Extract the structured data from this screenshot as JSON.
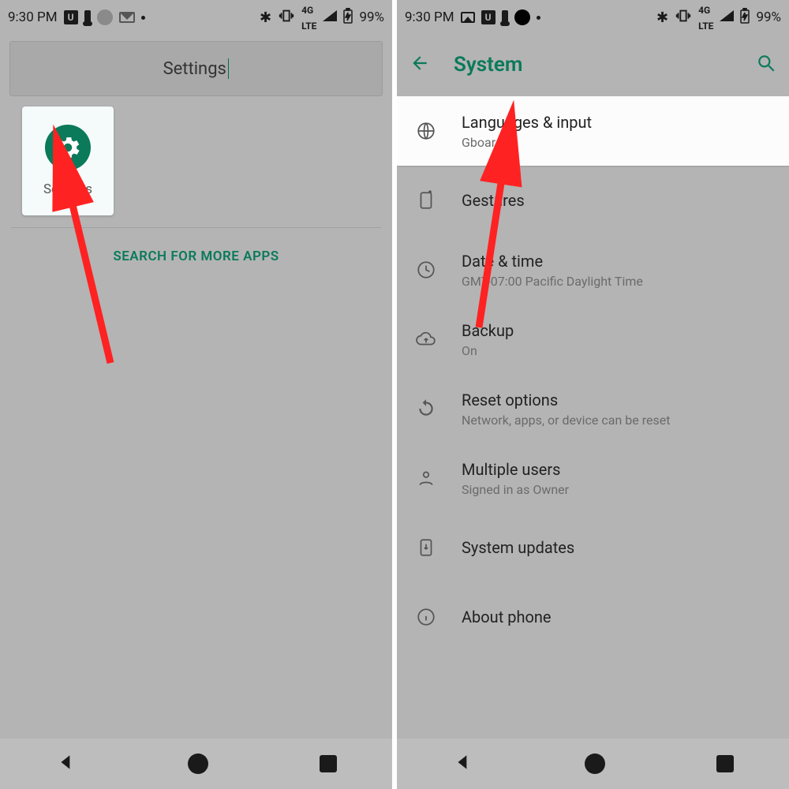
{
  "left": {
    "status": {
      "time": "9:30 PM",
      "net": "4G",
      "battery": "99%"
    },
    "search": {
      "placeholder": "Settings"
    },
    "app": {
      "label": "Settings"
    },
    "more_apps": "SEARCH FOR MORE APPS"
  },
  "right": {
    "status": {
      "time": "9:30 PM",
      "net": "4G",
      "battery": "99%"
    },
    "header": {
      "title": "System"
    },
    "items": [
      {
        "title": "Languages & input",
        "sub": "Gboard"
      },
      {
        "title": "Gestures",
        "sub": ""
      },
      {
        "title": "Date & time",
        "sub": "GMT-07:00 Pacific Daylight Time"
      },
      {
        "title": "Backup",
        "sub": "On"
      },
      {
        "title": "Reset options",
        "sub": "Network, apps, or device can be reset"
      },
      {
        "title": "Multiple users",
        "sub": "Signed in as Owner"
      },
      {
        "title": "System updates",
        "sub": ""
      },
      {
        "title": "About phone",
        "sub": ""
      }
    ]
  }
}
